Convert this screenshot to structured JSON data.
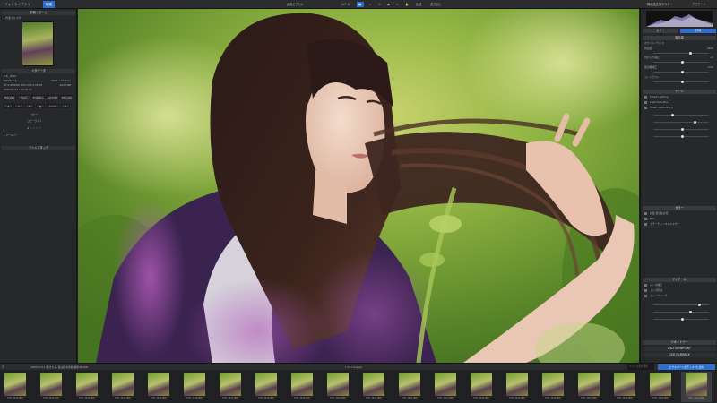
{
  "topbar": {
    "tabs": [
      "フォトライブラリ",
      "現像"
    ],
    "active_tab": "現像",
    "view_label": "画像ピクセル",
    "zoom": "143 %",
    "compare_label": "比較",
    "export_label": "書き出し",
    "right_items": [
      "構成設定をマスター",
      "アプデート"
    ]
  },
  "left_panel": {
    "nav_title": "情報 / ズーム",
    "item_line": "▸ 作業フォルダ",
    "meta_title": "メタデータ",
    "camera": "Z 6_ 2016",
    "lens": "AF-S NIKKOR 105mm f/1.4E ED",
    "meta_rows": [
      {
        "k": "NIKON Z 6",
        "v": "6048 x 4024 px"
      },
      {
        "k": "AF-S NIKKOR 105mm f/1.4E ED",
        "v": "4024 MB"
      },
      {
        "k": "2020/07/11 / 10:24:23",
        "v": ""
      }
    ],
    "exif": [
      "ISO 100",
      "f/2.2",
      "1/1600 s",
      "+0.3 EV",
      "105 mm"
    ],
    "rating_label": "★ ☆ ☆ ☆ ☆",
    "buttons": [
      "◀",
      "A",
      "B",
      "●",
      "-",
      "Undo",
      "⊕"
    ],
    "copy_label": "コピー",
    "apply_label": "コピーライト",
    "tool_title": "▸ ツールバー",
    "bottom_title": "アシャスタッグ"
  },
  "right_panel": {
    "histogram_label": "ヒストグラム",
    "tabs": [
      "カラー",
      "詳細"
    ],
    "sections": [
      {
        "title": "露出量",
        "rows": [
          "ホワイトバランス",
          "色温度",
          "色かぶり補正",
          "露出量補正",
          "コントラスト"
        ]
      },
      {
        "title": "トーン",
        "rows": [
          "Smart Lighting",
          "ClearView Plus",
          "Smart Obstruction"
        ]
      },
      {
        "title": "カラー",
        "rows": [
          "彩度/自然な彩度",
          "HSL",
          "カラーチャンネルミキサー"
        ]
      },
      {
        "title": "ディテール",
        "rows": [
          "レンズ補正",
          "ノイズ低減",
          "シャープニング"
        ]
      },
      {
        "title": "ジオメトリー",
        "rows": []
      }
    ],
    "temp_value": "5400",
    "tint_value": "+2",
    "exposure_value": "0.00",
    "viewpoint_label": "DXO VIEWPOINT",
    "filmpack_label": "DXO FILMPACK"
  },
  "filmbar": {
    "path": "2020/07/14 夏/まちみ, 藤山田中新緑/撮影/NIKON",
    "count": "1,351 images",
    "search_placeholder": "ファイル名を検索",
    "export_button": "エクスポートをディスクに出力"
  },
  "filmstrip": [
    "DSC_2419.NEF",
    "DSC_2412.NEF",
    "DSC_2413.NEF",
    "DSC_2414.NEF",
    "DSC_2415.NEF",
    "DSC_2416.NEF",
    "DSC_2417.NEF",
    "DSC_2418.NEF",
    "DSC_2419.NEF",
    "DSC_2420.NEF",
    "DSC_2421.NEF",
    "DSC_2422.NEF",
    "DSC_2423.NEF",
    "DSC_2424.NEF",
    "DSC_2425.NEF",
    "DSC_2426.NEF",
    "DSC_2427.NEF",
    "DSC_2428.NEF",
    "DSC_2429.NEF",
    "DSC_2430.NEF"
  ],
  "colors": {
    "accent": "#2f6fd1",
    "panel": "#27282a",
    "toolbar": "#2b2c2e"
  }
}
